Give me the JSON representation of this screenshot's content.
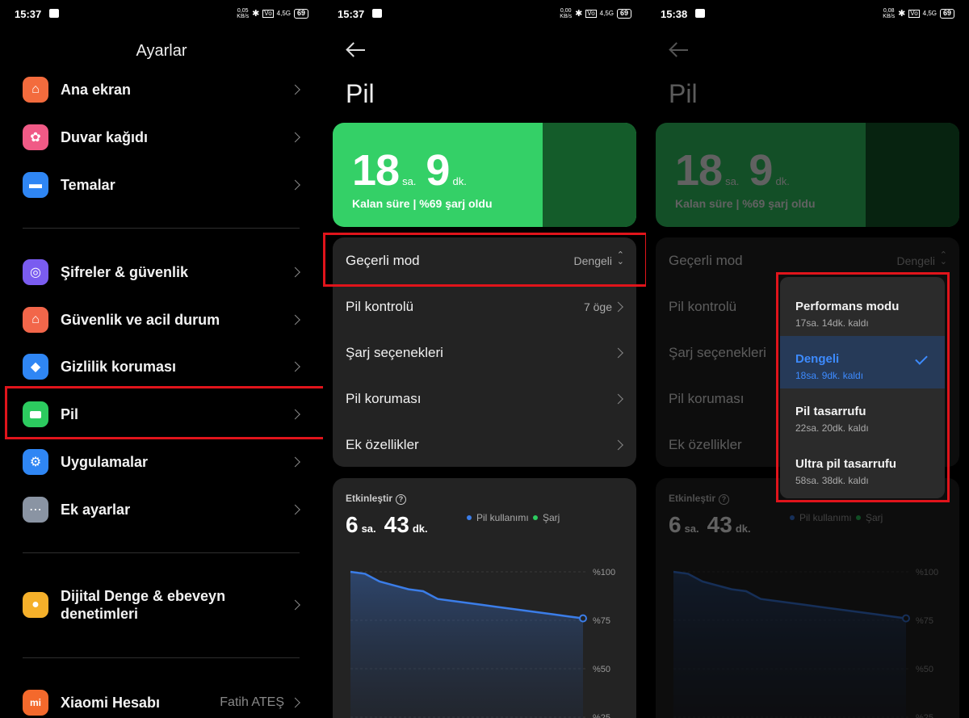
{
  "status_bar": [
    {
      "time": "15:37",
      "speed": [
        "0,05",
        "KB/s"
      ]
    },
    {
      "time": "15:37",
      "speed": [
        "0,00",
        "KB/s"
      ]
    },
    {
      "time": "15:38",
      "speed": [
        "0,08",
        "KB/s"
      ]
    }
  ],
  "status_common": {
    "signal": "4,5G",
    "battery": "69",
    "volte": "Vo"
  },
  "settings": {
    "title": "Ayarlar",
    "items": [
      {
        "label": "Ana ekran",
        "icon": "home-icon",
        "color": "#f36b3d"
      },
      {
        "label": "Duvar kağıdı",
        "icon": "flower-icon",
        "color": "#f05a86"
      },
      {
        "label": "Temalar",
        "icon": "brush-icon",
        "color": "#2f86f4"
      },
      {
        "label": "Şifreler & güvenlik",
        "icon": "fingerprint-icon",
        "color": "#7a5cf0"
      },
      {
        "label": "Güvenlik ve acil durum",
        "icon": "sos-icon",
        "color": "#f2664a"
      },
      {
        "label": "Gizlilik koruması",
        "icon": "privacy-icon",
        "color": "#2f86f4"
      },
      {
        "label": "Pil",
        "icon": "battery-icon",
        "color": "#2ccb5f"
      },
      {
        "label": "Uygulamalar",
        "icon": "gear-icon",
        "color": "#2f86f4"
      },
      {
        "label": "Ek ayarlar",
        "icon": "more-icon",
        "color": "#8a94a3"
      },
      {
        "label": "Dijital Denge & ebeveyn denetimleri",
        "icon": "digital-wellbeing-icon",
        "color": "#f5b02a"
      },
      {
        "label": "Xiaomi Hesabı",
        "icon": "mi-icon",
        "color": "#f4692c",
        "value": "Fatih ATEŞ"
      }
    ]
  },
  "battery": {
    "title": "Pil",
    "remaining": {
      "hours": "18",
      "hours_unit": "sa.",
      "minutes": "9",
      "minutes_unit": "dk."
    },
    "subtitle": "Kalan süre | %69 şarj oldu",
    "rows": [
      {
        "label": "Geçerli mod",
        "value": "Dengeli"
      },
      {
        "label": "Pil kontrolü",
        "value": "7 öge"
      },
      {
        "label": "Şarj seçenekleri",
        "value": ""
      },
      {
        "label": "Pil koruması",
        "value": ""
      },
      {
        "label": "Ek özellikler",
        "value": ""
      }
    ],
    "usage": {
      "heading": "Etkinleştir",
      "hours": "6",
      "hours_unit": "sa.",
      "minutes": "43",
      "minutes_unit": "dk.",
      "legend_usage": "Pil kullanımı",
      "legend_charge": "Şarj"
    }
  },
  "mode_popup": {
    "options": [
      {
        "title": "Performans modu",
        "subtitle": "17sa. 14dk. kaldı",
        "selected": false
      },
      {
        "title": "Dengeli",
        "subtitle": "18sa. 9dk. kaldı",
        "selected": true
      },
      {
        "title": "Pil tasarrufu",
        "subtitle": "22sa. 20dk. kaldı",
        "selected": false
      },
      {
        "title": "Ultra pil tasarrufu",
        "subtitle": "58sa. 38dk. kaldı",
        "selected": false
      }
    ]
  },
  "chart_data": {
    "type": "area",
    "title": "",
    "xlabel": "",
    "ylabel": "",
    "yticks": [
      "%100",
      "%75",
      "%50",
      "%25"
    ],
    "ylim": [
      0,
      100
    ],
    "series": [
      {
        "name": "Pil kullanımı",
        "color": "#3b7de8",
        "x": [
          0,
          1,
          2,
          3,
          4,
          5,
          6,
          7,
          8,
          9,
          10,
          11,
          12,
          13,
          14,
          15,
          16
        ],
        "values": [
          100,
          99,
          95,
          93,
          91,
          90,
          86,
          85,
          84,
          83,
          82,
          81,
          80,
          79,
          78,
          77,
          76
        ]
      }
    ],
    "legend": [
      {
        "name": "Pil kullanımı",
        "color": "#3b7de8"
      },
      {
        "name": "Şarj",
        "color": "#2ccb5f"
      }
    ],
    "grid": true
  },
  "colors": {
    "highlight": "#e0141b",
    "accent": "#3d8bff",
    "card": "#232323",
    "green": "#34d067"
  }
}
